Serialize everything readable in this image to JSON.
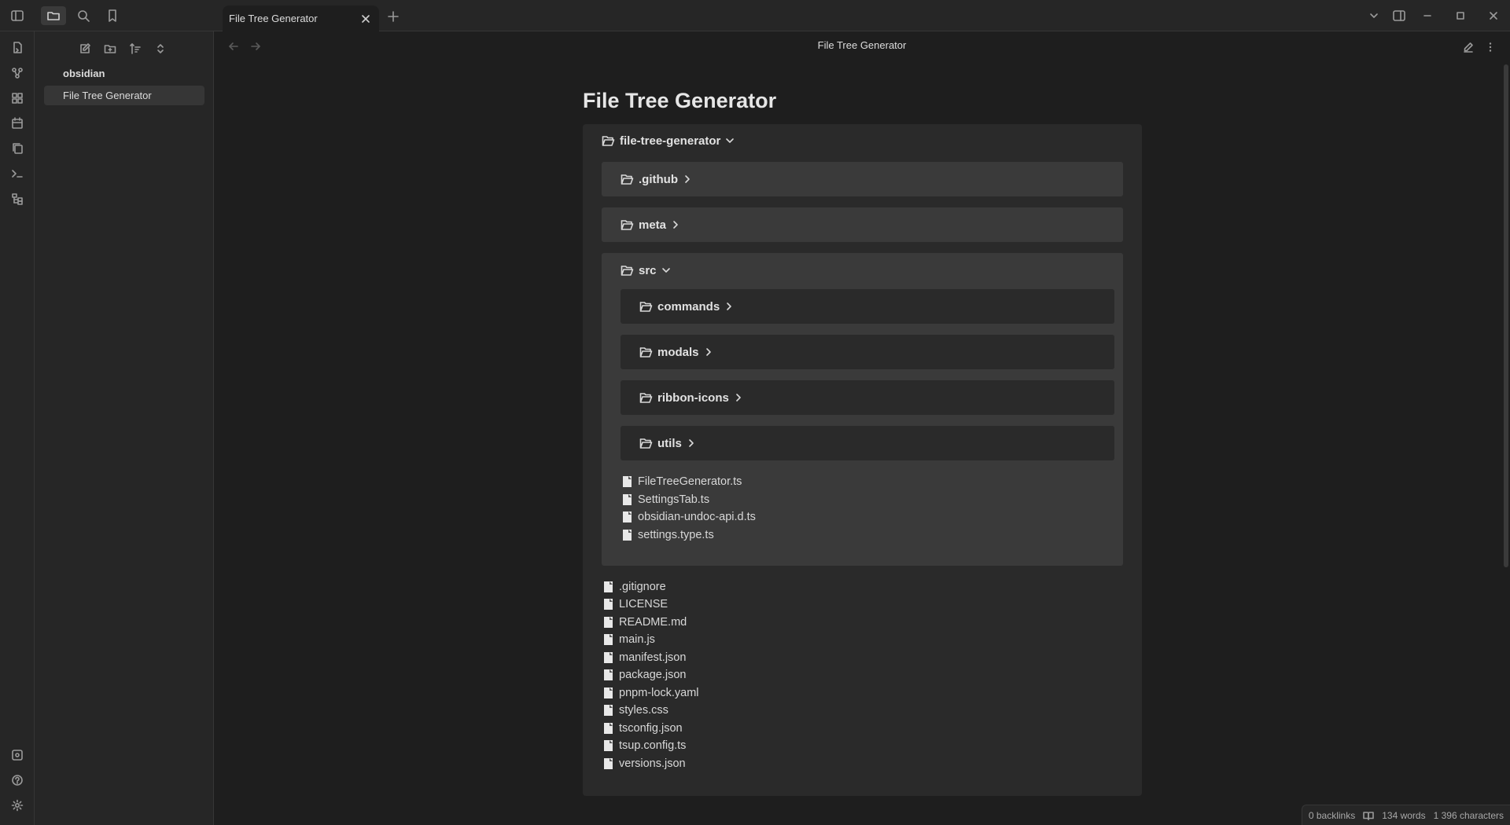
{
  "titlebar": {
    "tab_title": "File Tree Generator"
  },
  "sidebar": {
    "vault_name": "obsidian",
    "files": [
      "File Tree Generator"
    ]
  },
  "view": {
    "header_title": "File Tree Generator",
    "page_title": "File Tree Generator"
  },
  "tree": {
    "root": "file-tree-generator",
    "top_folders": [
      ".github",
      "meta"
    ],
    "src": {
      "name": "src",
      "subfolders": [
        "commands",
        "modals",
        "ribbon-icons",
        "utils"
      ],
      "files": [
        "FileTreeGenerator.ts",
        "SettingsTab.ts",
        "obsidian-undoc-api.d.ts",
        "settings.type.ts"
      ]
    },
    "root_files": [
      ".gitignore",
      "LICENSE",
      "README.md",
      "main.js",
      "manifest.json",
      "package.json",
      "pnpm-lock.yaml",
      "styles.css",
      "tsconfig.json",
      "tsup.config.ts",
      "versions.json"
    ]
  },
  "statusbar": {
    "backlinks": "0 backlinks",
    "words": "134 words",
    "characters": "1 396 characters"
  }
}
